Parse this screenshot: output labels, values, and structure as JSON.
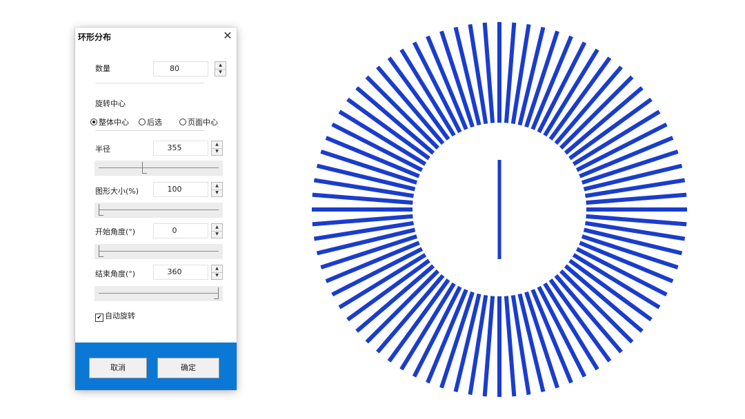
{
  "dialog": {
    "title": "环形分布",
    "close_icon": "close-icon",
    "count": {
      "label": "数量",
      "value": "80"
    },
    "rotation_center": {
      "label": "旋转中心",
      "options": [
        {
          "label": "整体中心",
          "selected": true
        },
        {
          "label": "后选",
          "selected": false
        },
        {
          "label": "页面中心",
          "selected": false
        }
      ]
    },
    "radius": {
      "label": "半径",
      "value": "355",
      "slider_fraction": 0.38
    },
    "shape_size": {
      "label": "图形大小(%)",
      "value": "100",
      "slider_fraction": 0.0
    },
    "start_angle": {
      "label": "开始角度(°)",
      "value": "0",
      "slider_fraction": 0.0
    },
    "end_angle": {
      "label": "结束角度(°)",
      "value": "360",
      "slider_fraction": 1.0
    },
    "auto_rotate": {
      "label": "自动旋转",
      "checked": true
    },
    "buttons": {
      "cancel": "取消",
      "ok": "确定"
    },
    "accent_color": "#0a78d4"
  },
  "graphic": {
    "bar_count": 80,
    "bar_color": "#1a3dcc",
    "center_bar": true
  }
}
